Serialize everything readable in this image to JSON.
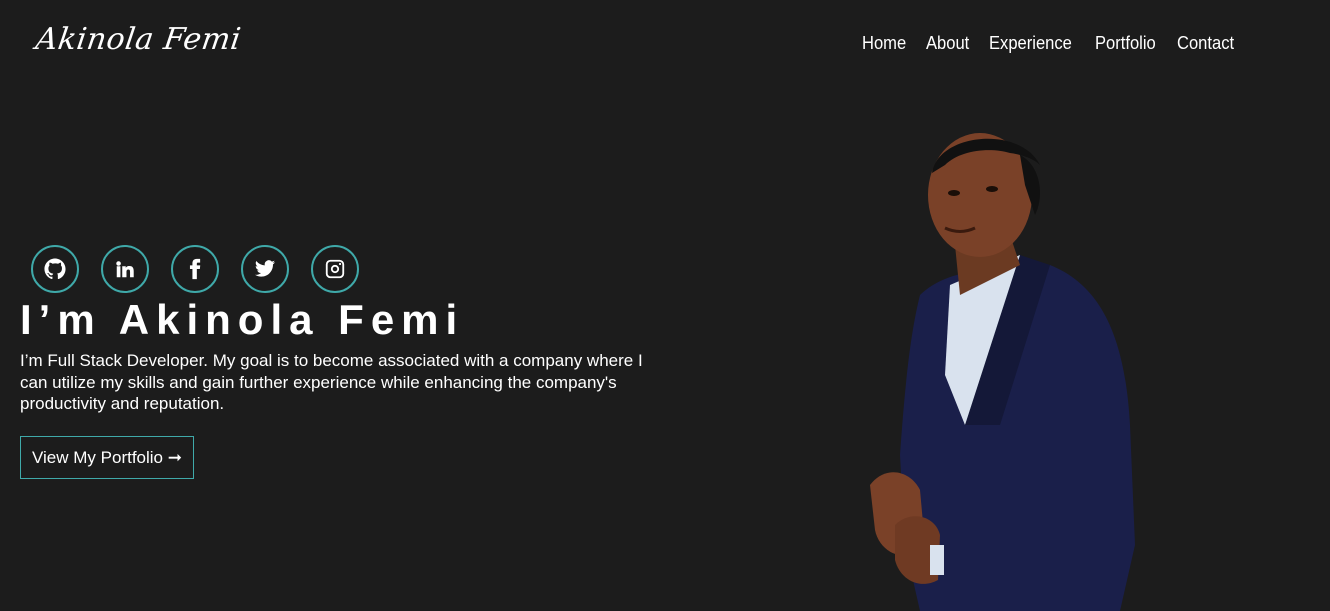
{
  "header": {
    "logo_text": "Akinola Femi",
    "nav": [
      "Home",
      "About",
      "Experience",
      "Portfolio",
      "Contact"
    ]
  },
  "socials": [
    {
      "icon": "github-icon"
    },
    {
      "icon": "linkedin-icon"
    },
    {
      "icon": "facebook-icon"
    },
    {
      "icon": "twitter-icon"
    },
    {
      "icon": "instagram-icon"
    }
  ],
  "hero": {
    "title": "I’m Akinola Femi",
    "description": "I’m Full Stack Developer. My goal is to become associated with a company where I can utilize my skills and gain further experience while enhancing the company's productivity and reputation.",
    "cta_label": "View My Portfolio ➞"
  },
  "colors": {
    "background": "#1c1c1c",
    "accent": "#3fa9a9",
    "text": "#ffffff"
  }
}
